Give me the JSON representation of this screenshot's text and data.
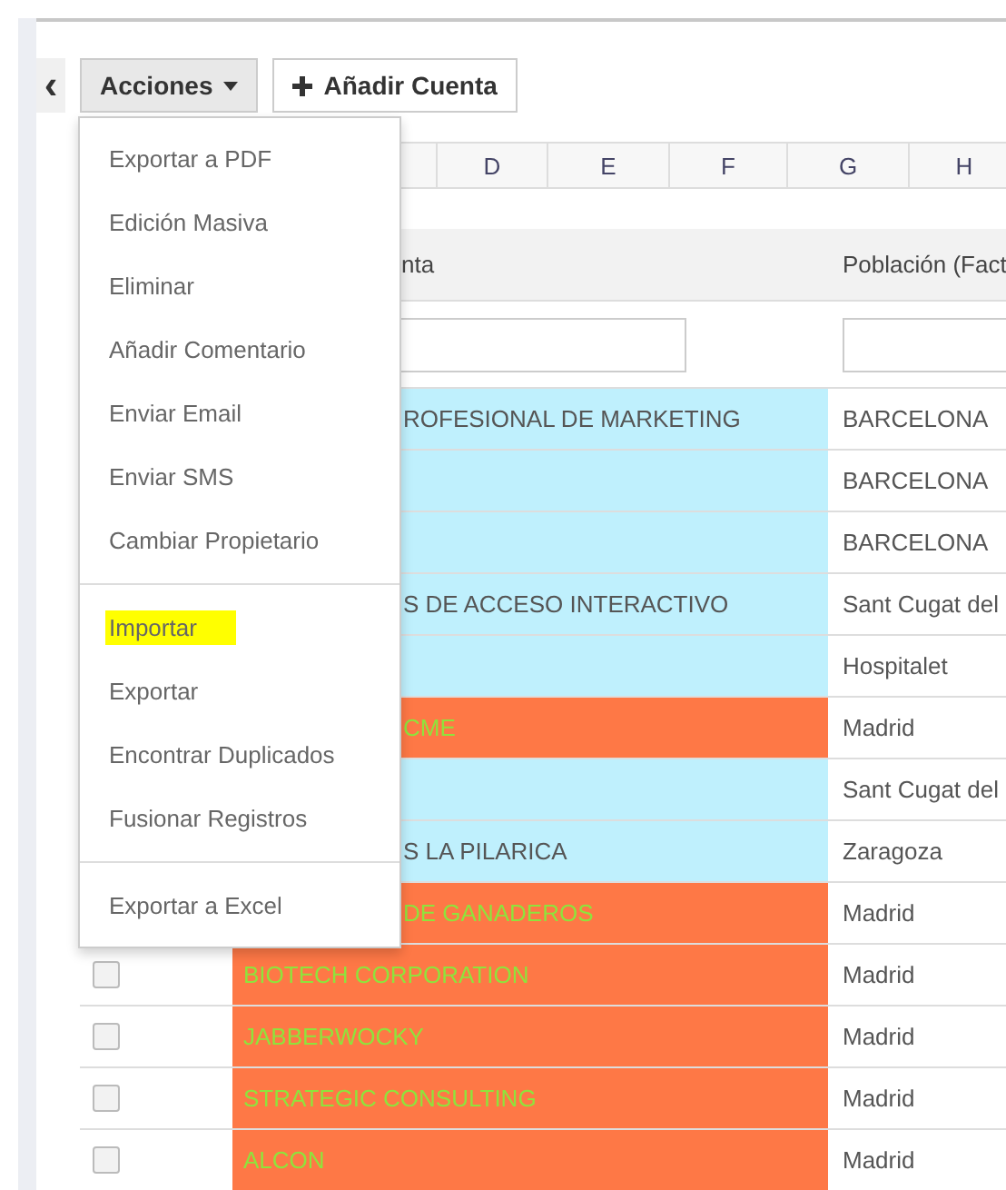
{
  "toolbar": {
    "collapse_icon": "‹",
    "actions_button": "Acciones",
    "add_button": "Añadir Cuenta"
  },
  "column_letters": [
    "D",
    "E",
    "F",
    "G",
    "H"
  ],
  "table": {
    "columns": [
      "nta",
      "Población (Fact"
    ],
    "rows": [
      {
        "kind": "normal",
        "name": "ROFESIONAL DE MARKETING",
        "city": "BARCELONA"
      },
      {
        "kind": "normal",
        "name": "",
        "city": "BARCELONA"
      },
      {
        "kind": "normal",
        "name": "",
        "city": "BARCELONA"
      },
      {
        "kind": "normal",
        "name": "S DE ACCESO INTERACTIVO",
        "city": "Sant Cugat del"
      },
      {
        "kind": "normal",
        "name": "",
        "city": "Hospitalet"
      },
      {
        "kind": "alert",
        "name": "CME",
        "city": "Madrid"
      },
      {
        "kind": "normal",
        "name": "",
        "city": "Sant Cugat del"
      },
      {
        "kind": "normal",
        "name": "S LA PILARICA",
        "city": "Zaragoza"
      },
      {
        "kind": "alert",
        "name": "DE GANADEROS",
        "city": "Madrid"
      },
      {
        "kind": "alert",
        "name": "BIOTECH CORPORATION",
        "city": "Madrid",
        "checked": false
      },
      {
        "kind": "alert",
        "name": "JABBERWOCKY",
        "city": "Madrid",
        "checked": false
      },
      {
        "kind": "alert",
        "name": "STRATEGIC CONSULTING",
        "city": "Madrid",
        "checked": false
      },
      {
        "kind": "alert",
        "name": "ALCON",
        "city": "Madrid",
        "checked": false
      }
    ]
  },
  "menu": {
    "items": [
      {
        "kind": "item",
        "label": "Exportar a PDF",
        "highlighted": false
      },
      {
        "kind": "item",
        "label": "Edición Masiva",
        "highlighted": false
      },
      {
        "kind": "item",
        "label": "Eliminar",
        "highlighted": false
      },
      {
        "kind": "item",
        "label": "Añadir Comentario",
        "highlighted": false
      },
      {
        "kind": "item",
        "label": "Enviar Email",
        "highlighted": false
      },
      {
        "kind": "item",
        "label": "Enviar SMS",
        "highlighted": false
      },
      {
        "kind": "item",
        "label": "Cambiar Propietario",
        "highlighted": false
      },
      {
        "kind": "divider"
      },
      {
        "kind": "item",
        "label": "Importar",
        "highlighted": true
      },
      {
        "kind": "item",
        "label": "Exportar",
        "highlighted": false
      },
      {
        "kind": "item",
        "label": "Encontrar Duplicados",
        "highlighted": false
      },
      {
        "kind": "item",
        "label": "Fusionar Registros",
        "highlighted": false
      },
      {
        "kind": "divider"
      },
      {
        "kind": "item",
        "label": "Exportar a Excel",
        "highlighted": false
      }
    ]
  }
}
